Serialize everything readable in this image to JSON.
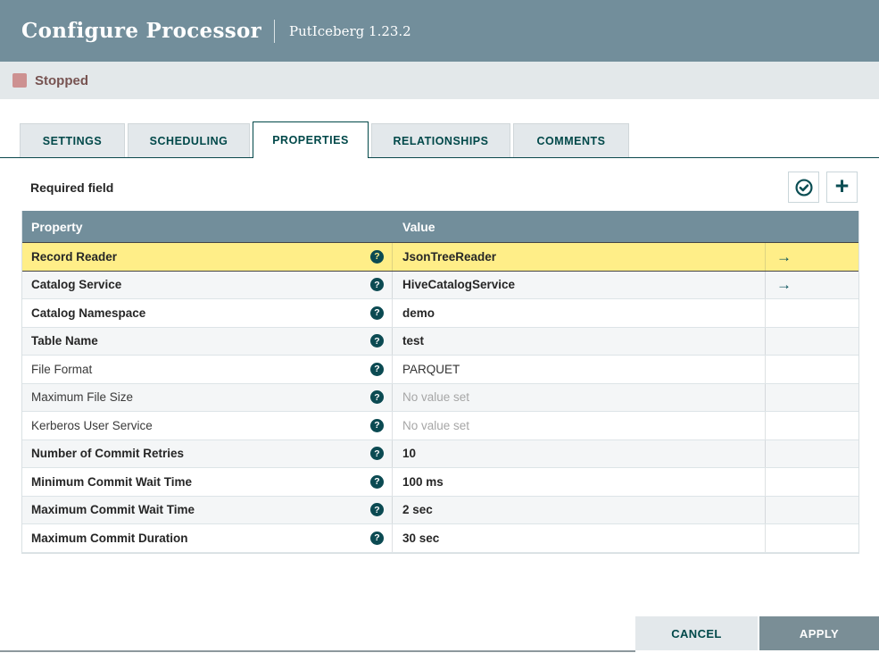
{
  "dialog": {
    "title": "Configure Processor",
    "subtitle": "PutIceberg 1.23.2"
  },
  "status": {
    "label": "Stopped",
    "square_color": "#cd9191",
    "text_color": "#775351"
  },
  "tabs": [
    {
      "label": "SETTINGS",
      "active": false
    },
    {
      "label": "SCHEDULING",
      "active": false
    },
    {
      "label": "PROPERTIES",
      "active": true
    },
    {
      "label": "RELATIONSHIPS",
      "active": false
    },
    {
      "label": "COMMENTS",
      "active": false
    }
  ],
  "toolbar": {
    "legend": "Required field",
    "buttons": [
      "verify-properties",
      "add-property"
    ]
  },
  "table": {
    "columns": {
      "property": "Property",
      "value": "Value"
    },
    "rows": [
      {
        "property": "Record Reader",
        "value": "JsonTreeReader",
        "required": true,
        "value_set": true,
        "has_arrow": true,
        "highlighted": true
      },
      {
        "property": "Catalog Service",
        "value": "HiveCatalogService",
        "required": true,
        "value_set": true,
        "has_arrow": true,
        "highlighted": false
      },
      {
        "property": "Catalog Namespace",
        "value": "demo",
        "required": true,
        "value_set": true,
        "has_arrow": false,
        "highlighted": false
      },
      {
        "property": "Table Name",
        "value": "test",
        "required": true,
        "value_set": true,
        "has_arrow": false,
        "highlighted": false
      },
      {
        "property": "File Format",
        "value": "PARQUET",
        "required": false,
        "value_set": true,
        "has_arrow": false,
        "highlighted": false
      },
      {
        "property": "Maximum File Size",
        "value": "No value set",
        "required": false,
        "value_set": false,
        "has_arrow": false,
        "highlighted": false
      },
      {
        "property": "Kerberos User Service",
        "value": "No value set",
        "required": false,
        "value_set": false,
        "has_arrow": false,
        "highlighted": false
      },
      {
        "property": "Number of Commit Retries",
        "value": "10",
        "required": true,
        "value_set": true,
        "has_arrow": false,
        "highlighted": false
      },
      {
        "property": "Minimum Commit Wait Time",
        "value": "100 ms",
        "required": true,
        "value_set": true,
        "has_arrow": false,
        "highlighted": false
      },
      {
        "property": "Maximum Commit Wait Time",
        "value": "2 sec",
        "required": true,
        "value_set": true,
        "has_arrow": false,
        "highlighted": false
      },
      {
        "property": "Maximum Commit Duration",
        "value": "30 sec",
        "required": true,
        "value_set": true,
        "has_arrow": false,
        "highlighted": false
      }
    ]
  },
  "icons": {
    "help_glyph": "?",
    "plus_glyph": "+",
    "arrow_glyph": "→"
  },
  "footer": {
    "cancel_label": "CANCEL",
    "apply_label": "APPLY"
  },
  "colors": {
    "header_bg": "#728e9b",
    "accent_teal": "#004849",
    "highlight_row": "#ffee88",
    "row_alt": "#f4f6f7",
    "status_bar_bg": "#e3e8ea"
  }
}
